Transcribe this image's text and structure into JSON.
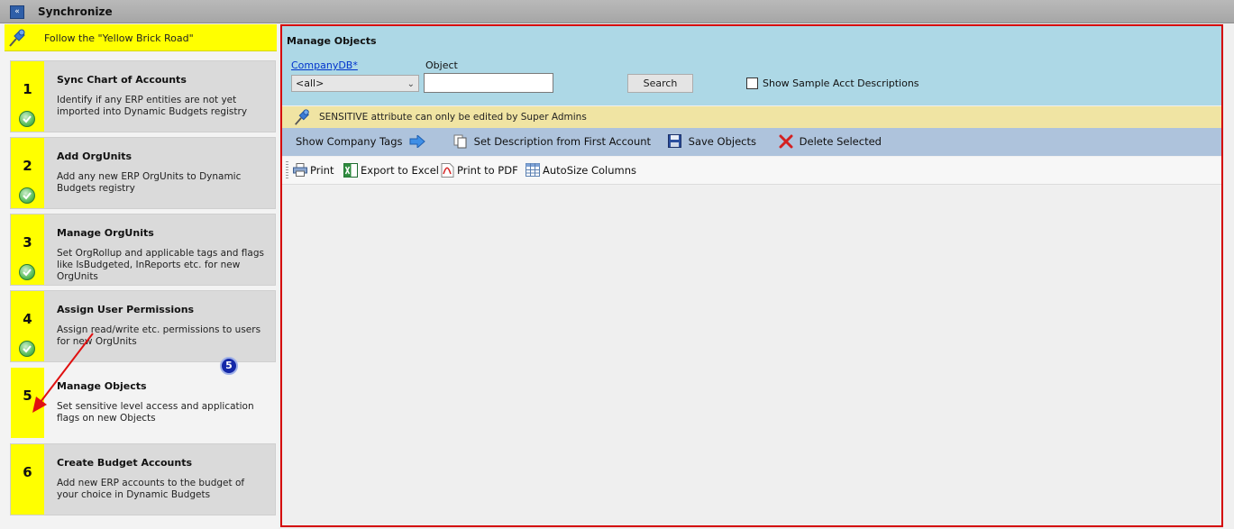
{
  "titlebar": {
    "title": "Synchronize",
    "collapse_glyph": "«"
  },
  "sidebar": {
    "ybr_text": "Follow the \"Yellow Brick Road\"",
    "steps": [
      {
        "number": "1",
        "title": "Sync Chart of Accounts",
        "desc": "Identify if any ERP entities are not yet imported into Dynamic Budgets registry",
        "completed": true
      },
      {
        "number": "2",
        "title": "Add OrgUnits",
        "desc": "Add any new ERP OrgUnits to Dynamic Budgets registry",
        "completed": true
      },
      {
        "number": "3",
        "title": "Manage OrgUnits",
        "desc": "Set OrgRollup and applicable tags and flags like IsBudgeted, InReports etc. for new OrgUnits",
        "completed": true
      },
      {
        "number": "4",
        "title": "Assign User Permissions",
        "desc": "Assign read/write etc. permissions to users for new OrgUnits",
        "completed": true
      },
      {
        "number": "5",
        "title": "Manage Objects",
        "desc": "Set sensitive level access and application flags on new Objects",
        "completed": false,
        "active": true
      },
      {
        "number": "6",
        "title": "Create Budget Accounts",
        "desc": "Add new ERP accounts to the budget of your choice in Dynamic Budgets",
        "completed": false
      }
    ],
    "step_badge": "5"
  },
  "main": {
    "title": "Manage Objects",
    "company_label": "CompanyDB*",
    "company_value": "<all>",
    "object_label": "Object",
    "object_value": "",
    "search_label": "Search",
    "show_sample_label": "Show Sample Acct Descriptions",
    "show_sample_checked": false,
    "notice": "SENSITIVE attribute can only be edited by Super Admins",
    "actions": {
      "show_tags": "Show Company Tags",
      "set_desc": "Set Description from First Account",
      "save": "Save Objects",
      "delete": "Delete Selected"
    },
    "toolbar": {
      "print": "Print",
      "export": "Export to Excel",
      "pdf": "Print to PDF",
      "autosize": "AutoSize Columns"
    }
  },
  "colors": {
    "highlight_yellow": "#ffff00",
    "panel_border": "#d40000",
    "header_blue": "#add8e6",
    "notice_yellow": "#f0e4a3",
    "actionbar_blue": "#aec3dc"
  }
}
